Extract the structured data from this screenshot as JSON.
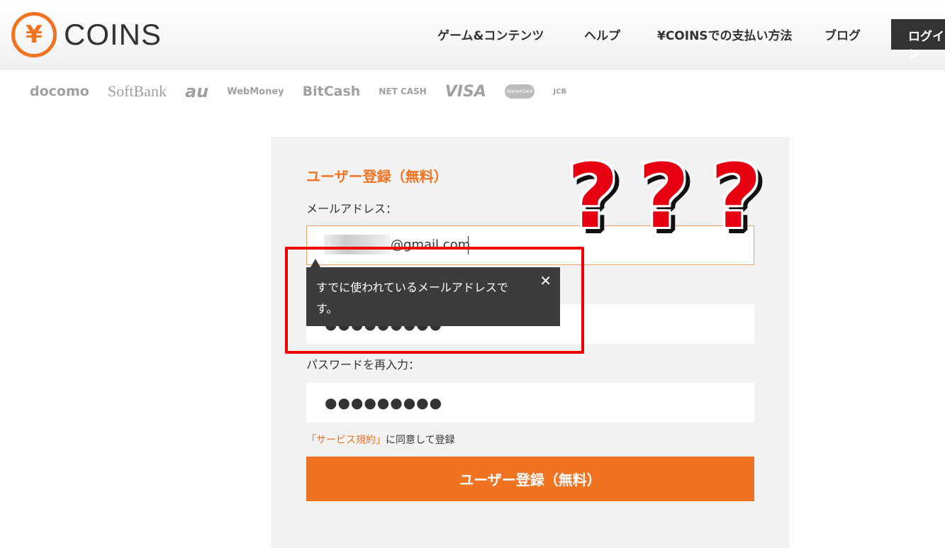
{
  "header": {
    "logo_symbol": "¥",
    "logo_text": "COINS",
    "nav": [
      "ゲーム&コンテンツ",
      "ヘルプ",
      "¥COINSでの支払い方法",
      "ブログ"
    ],
    "login": "ログイン"
  },
  "payments": [
    "docomo",
    "SoftBank",
    "au",
    "WebMoney",
    "BitCash",
    "NET CASH",
    "VISA",
    "MasterCard",
    "JCB"
  ],
  "form": {
    "title": "ユーザー登録（無料）",
    "email_label": "メールアドレス：",
    "email_value": "@gmail.com",
    "password_mask": "●●●●●●●●●",
    "password_confirm_label": "パスワードを再入力：",
    "password_confirm_mask": "●●●●●●●●●",
    "terms_link": "「サービス規約」",
    "terms_text": "に同意して登録",
    "submit": "ユーザー登録（無料）"
  },
  "tooltip": {
    "message": "すでに使われているメールアドレスです。",
    "close": "✕"
  },
  "annotation": {
    "marks": "?"
  },
  "colors": {
    "accent": "#f07322",
    "highlight": "#e00000",
    "tooltip_bg": "#3c3c3c"
  }
}
